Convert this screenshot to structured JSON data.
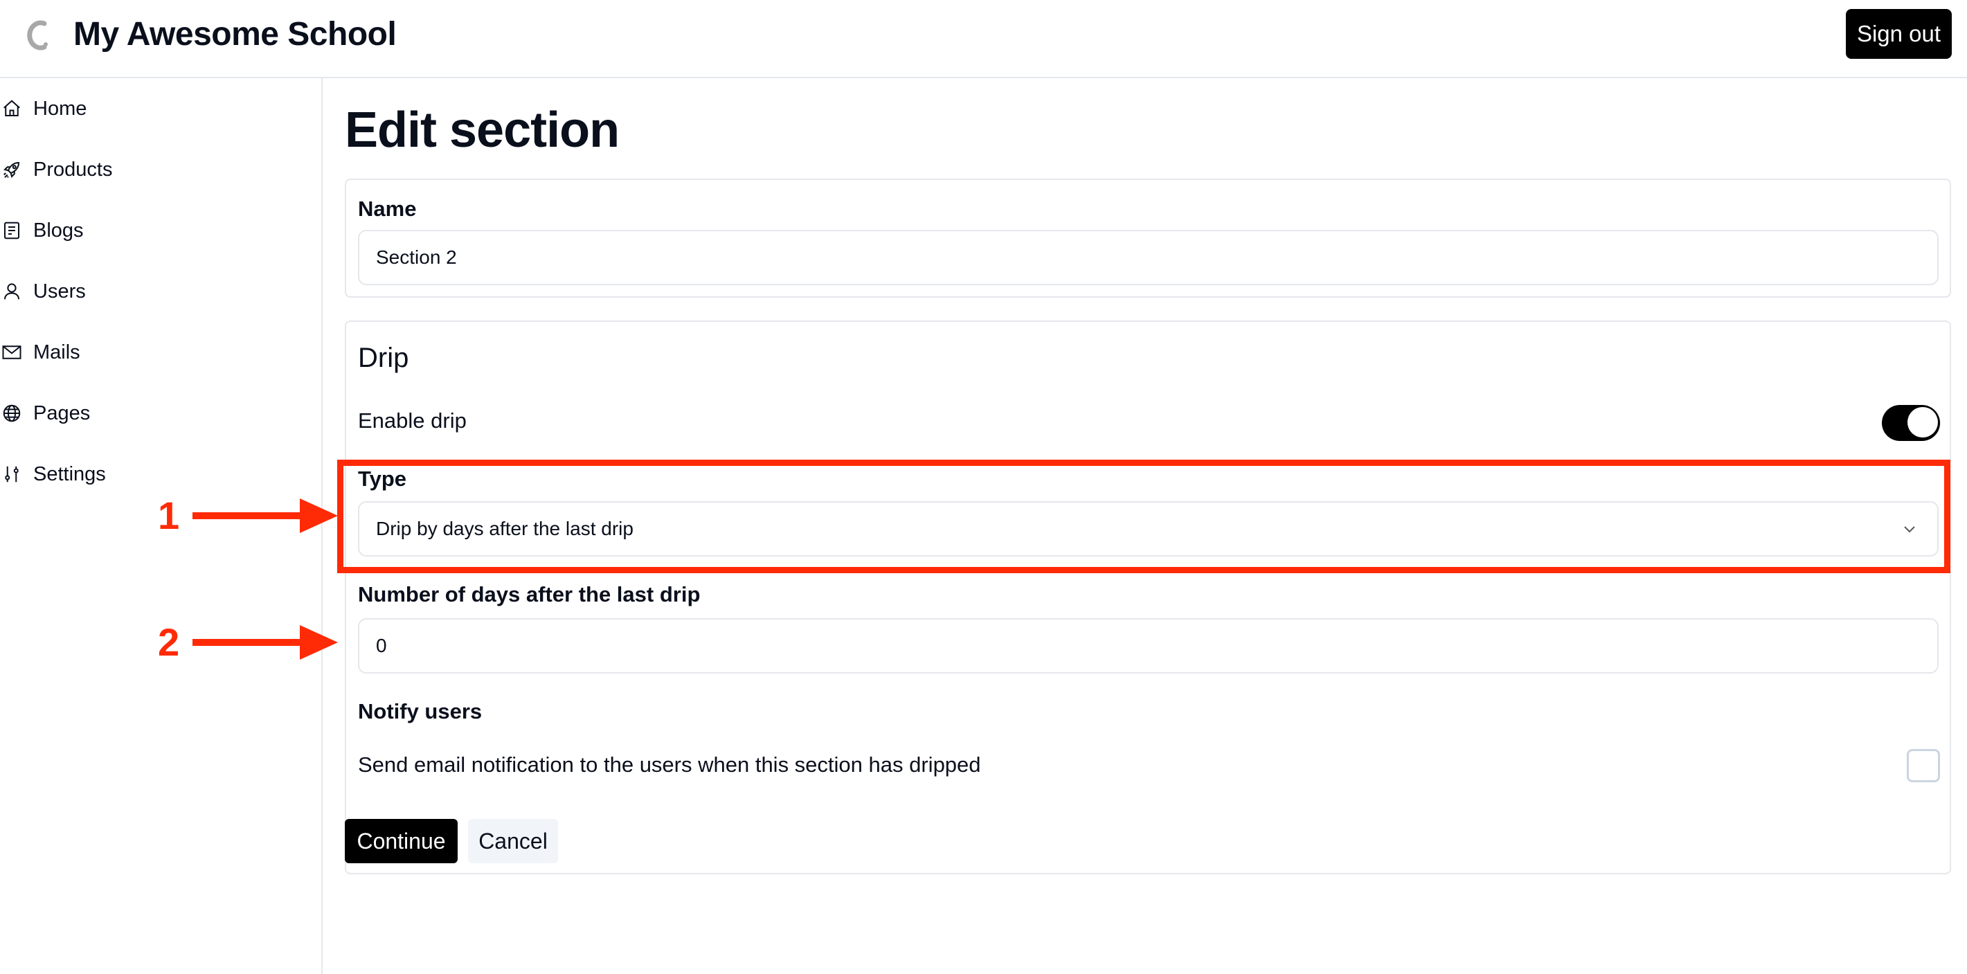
{
  "header": {
    "logo_icon": "school-logo-icon",
    "title": "My Awesome School",
    "signout_label": "Sign out"
  },
  "sidebar": {
    "items": [
      {
        "label": "Home",
        "icon": "home-icon"
      },
      {
        "label": "Products",
        "icon": "rocket-icon"
      },
      {
        "label": "Blogs",
        "icon": "document-icon"
      },
      {
        "label": "Users",
        "icon": "user-icon"
      },
      {
        "label": "Mails",
        "icon": "mail-icon"
      },
      {
        "label": "Pages",
        "icon": "globe-icon"
      },
      {
        "label": "Settings",
        "icon": "sliders-icon"
      }
    ]
  },
  "main": {
    "title": "Edit section",
    "name_card": {
      "label": "Name",
      "value": "Section 2"
    },
    "drip_card": {
      "heading": "Drip",
      "enable_label": "Enable drip",
      "enable_on": true,
      "type_label": "Type",
      "type_value": "Drip by days after the last drip",
      "days_label": "Number of days after the last drip",
      "days_value": "0",
      "notify_label": "Notify users",
      "notify_description": "Send email notification to the users when this section has dripped",
      "notify_checked": false
    },
    "buttons": {
      "continue": "Continue",
      "cancel": "Cancel"
    }
  },
  "annotations": {
    "color": "#ff2a06",
    "markers": [
      "1",
      "2"
    ]
  }
}
